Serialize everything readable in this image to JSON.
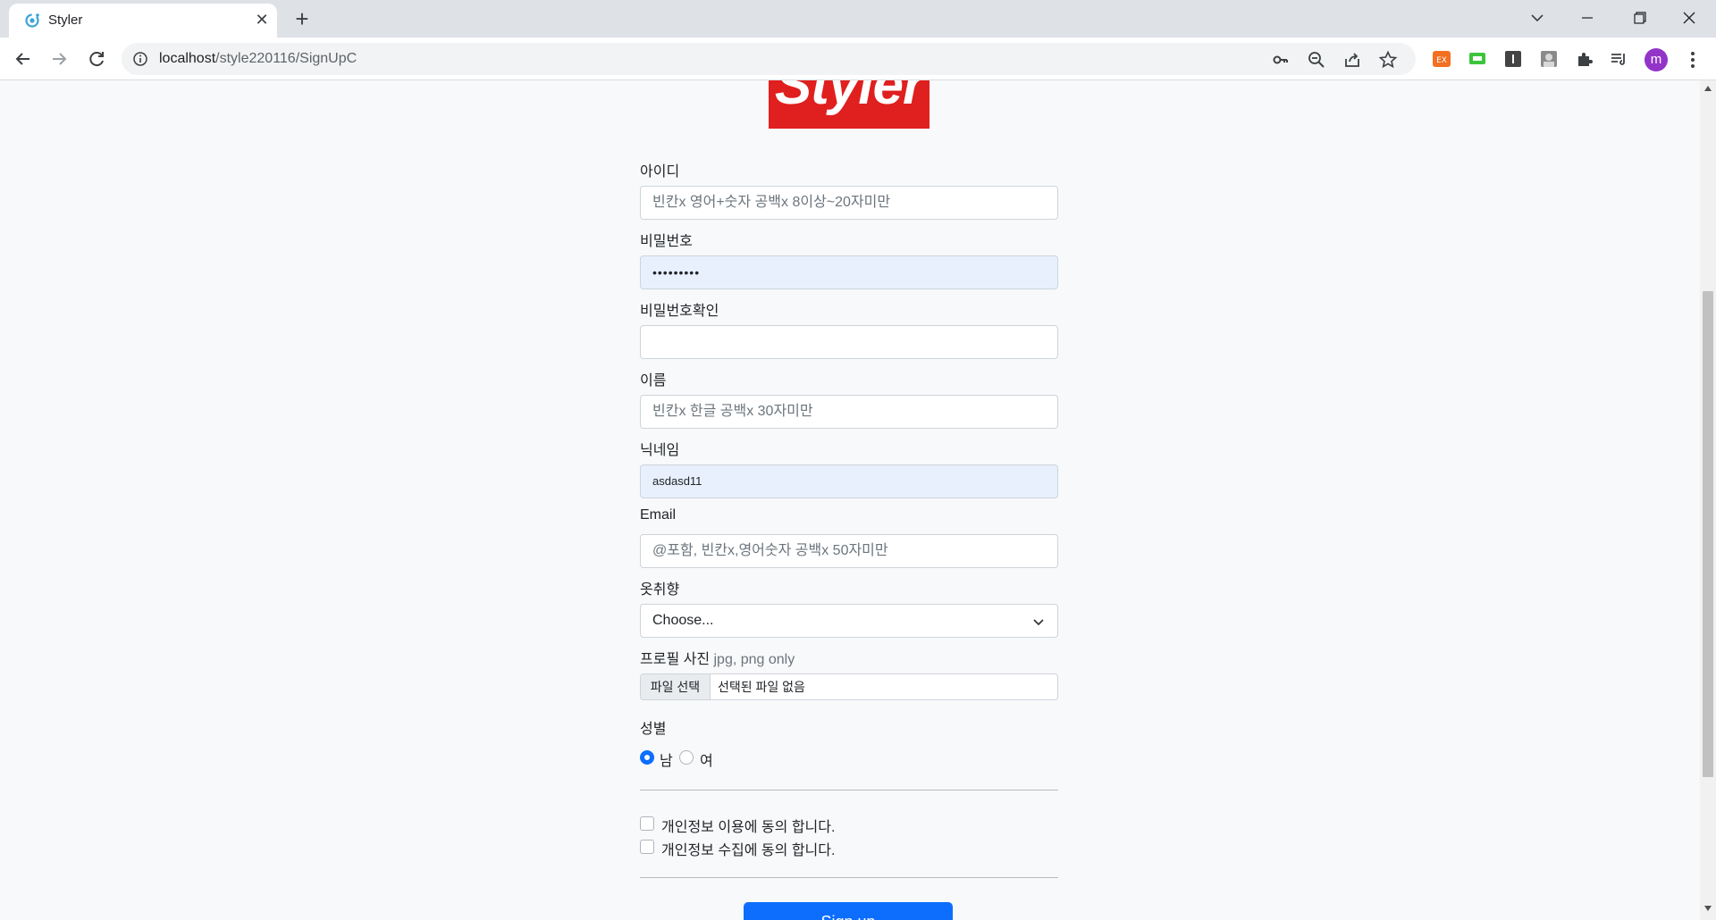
{
  "browser": {
    "tab_title": "Styler",
    "url_host": "localhost",
    "url_path": "/style220116/SignUpC",
    "avatar_letter": "m"
  },
  "logo": {
    "text": "Styler",
    "color": "#e01f1f"
  },
  "form": {
    "userid": {
      "label": "아이디",
      "placeholder": "빈칸x 영어+숫자 공백x 8이상~20자미만"
    },
    "password": {
      "label": "비밀번호",
      "masked_value": "•••••••••"
    },
    "password_confirm": {
      "label": "비밀번호확인"
    },
    "name": {
      "label": "이름",
      "placeholder": "빈칸x 한글 공백x 30자미만"
    },
    "nickname": {
      "label": "닉네임",
      "value": "asdasd11"
    },
    "email": {
      "label": "Email",
      "placeholder": "@포함, 빈칸x,영어숫자 공백x 50자미만"
    },
    "style": {
      "label": "옷취향",
      "selected": "Choose..."
    },
    "profile": {
      "label": "프로필 사진",
      "hint": "jpg, png only",
      "button": "파일 선택",
      "status": "선택된 파일 없음"
    },
    "gender": {
      "label": "성별",
      "options": [
        "남",
        "여"
      ],
      "selected": "남"
    },
    "agreements": [
      "개인정보 이용에 동의 합니다.",
      "개인정보 수집에 동의 합니다."
    ],
    "submit_label": "Sign up"
  },
  "colors": {
    "accent": "#0d6efd",
    "autofill_bg": "#e8f0fe"
  }
}
